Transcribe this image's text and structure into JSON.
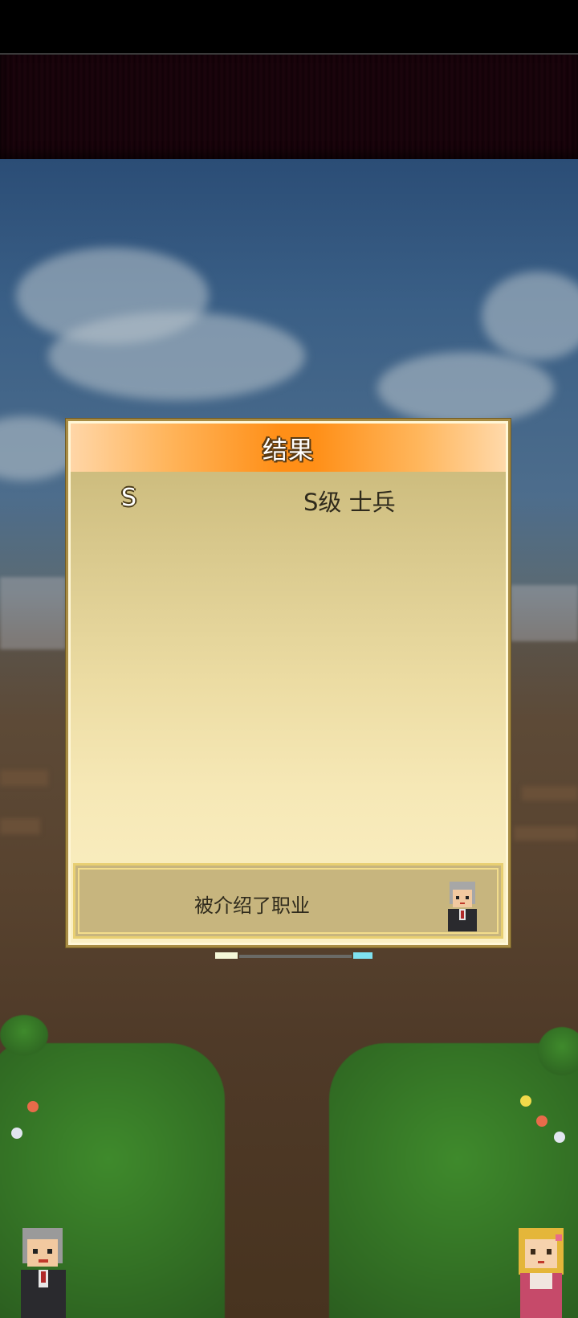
{
  "dialog": {
    "title": "结果",
    "grade": "S",
    "job": "S级 士兵",
    "message": "被介绍了职业"
  },
  "icons": {
    "advisor": "advisor-portrait-icon",
    "left_character": "elder-character-icon",
    "right_character": "girl-character-icon"
  },
  "colors": {
    "header_orange": "#ff8f17",
    "dialog_border": "#a88c44",
    "panel_bottom": "#fbf0c4"
  }
}
